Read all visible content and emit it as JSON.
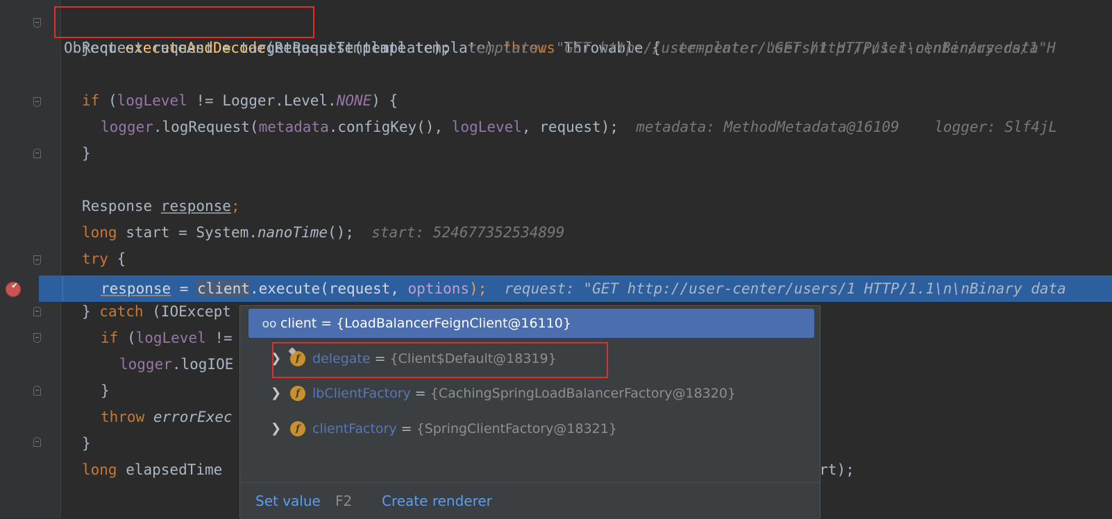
{
  "code": {
    "l1": {
      "kw_object": "Object ",
      "method": "executeAndDecode",
      "rest": "(RequestTemplate template) ",
      "throws": "throws",
      "rest2": " Throwable {",
      "hint": "template: \"GET http://user-center/users/1 H"
    },
    "l2": {
      "text": "Request request = targetRequest(template);",
      "hint": "template: \"GET http://user-center/users/1 HTTP/1.1\\n\\nBinary data\""
    },
    "l4": {
      "kw_if": "if",
      "p1": " (",
      "field": "logLevel",
      "p2": " != Logger.Level.",
      "const": "NONE",
      "p3": ") {"
    },
    "l5": {
      "field1": "logger",
      "p1": ".logRequest(",
      "field2": "metadata",
      "p2": ".configKey(), ",
      "field3": "logLevel",
      "p3": ", request);",
      "hint1": "metadata: MethodMetadata@16109",
      "hint2": "logger: Slf4jL"
    },
    "l6": {
      "text": "}"
    },
    "l8": {
      "p1": "Response ",
      "var": "response",
      "p2": ";"
    },
    "l9": {
      "kw_long": "long",
      "p1": " start = System.",
      "method": "nanoTime",
      "p2": "();",
      "hint": "start: 524677352534899"
    },
    "l10": {
      "kw_try": "try",
      "p1": " {"
    },
    "l11": {
      "var": "response",
      "p1": " = ",
      "client": "client",
      "p2": ".execute(request, ",
      "field": "options",
      "p3": ");",
      "hint": "request: \"GET http://user-center/users/1 HTTP/1.1\\n\\nBinary data"
    },
    "l12": {
      "p1": "} ",
      "kw_catch": "catch",
      "p2": " (IOExcept"
    },
    "l13": {
      "kw_if": "if",
      "p1": " (",
      "field": "logLevel",
      "p2": " !="
    },
    "l14": {
      "field": "logger",
      "p1": ".logIOE",
      "tail": ";"
    },
    "l15": {
      "text": "}"
    },
    "l16": {
      "kw_throw": "throw",
      "method": " errorExec"
    },
    "l17": {
      "text": "}"
    },
    "l18": {
      "kw_long": "long",
      "p1": " elapsedTime",
      "tail": "tart);"
    }
  },
  "popup": {
    "root": {
      "name": "client",
      "value": " = {LoadBalancerFeignClient@16110}"
    },
    "fields": [
      {
        "name": "delegate",
        "eq": " = ",
        "value": "{Client$Default@18319}"
      },
      {
        "name": "lbClientFactory",
        "eq": " = ",
        "value": "{CachingSpringLoadBalancerFactory@18320}"
      },
      {
        "name": "clientFactory",
        "eq": " = ",
        "value": "{SpringClientFactory@18321}"
      }
    ],
    "field_icon_letter": "f",
    "footer": {
      "set_value": "Set value",
      "set_value_key": "F2",
      "create_renderer": "Create renderer"
    }
  },
  "colors": {
    "keyword": "#cc7832",
    "method": "#ffc66d",
    "field": "#9876aa",
    "current_line": "#2d5f9e",
    "highlight_box": "#e0302a"
  }
}
